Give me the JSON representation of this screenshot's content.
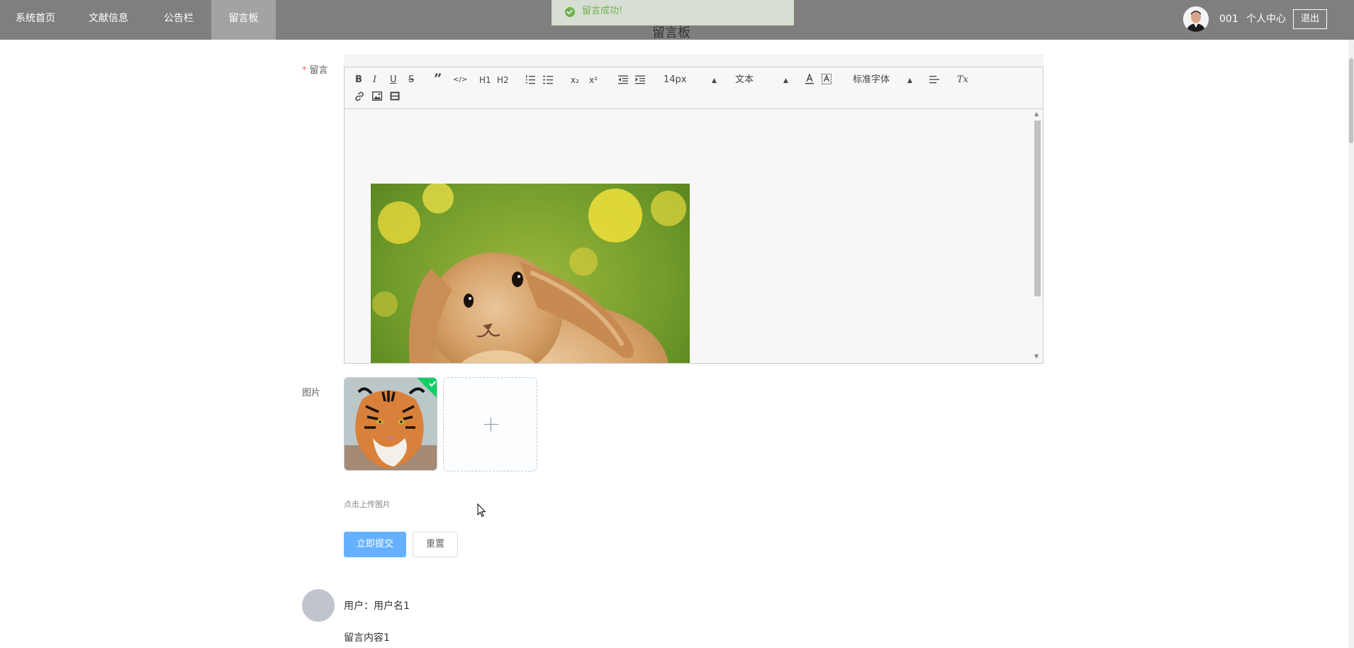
{
  "nav": {
    "items": [
      {
        "label": "系统首页",
        "active": false
      },
      {
        "label": "文献信息",
        "active": false
      },
      {
        "label": "公告栏",
        "active": false
      },
      {
        "label": "留言板",
        "active": true
      }
    ],
    "username": "001",
    "profile_label": "个人中心",
    "logout_label": "退出"
  },
  "toast": {
    "message": "留言成功!",
    "type": "success"
  },
  "page": {
    "title": "留言板"
  },
  "form": {
    "message_label": "留言",
    "image_label": "图片",
    "upload_hint": "点击上传图片",
    "submit_label": "立即提交",
    "reset_label": "重置"
  },
  "editor": {
    "font_size": "14px",
    "header_select": "文本",
    "font_family": "标准字体",
    "toolbar": {
      "bold": "B",
      "italic": "I",
      "underline": "U",
      "strike": "S",
      "quote": "”",
      "code": "</>",
      "h1": "H1",
      "h2": "H2",
      "sub": "x₂",
      "sup": "x²",
      "clean": "Tx"
    }
  },
  "comments": [
    {
      "user_label": "用户：用户名1",
      "content": "留言内容1"
    }
  ],
  "colors": {
    "nav_bg": "#7f7f7f",
    "nav_active_bg": "#a3a3a3",
    "primary": "#66b1ff",
    "success": "#67c23a",
    "upload_success": "#13ce66"
  }
}
